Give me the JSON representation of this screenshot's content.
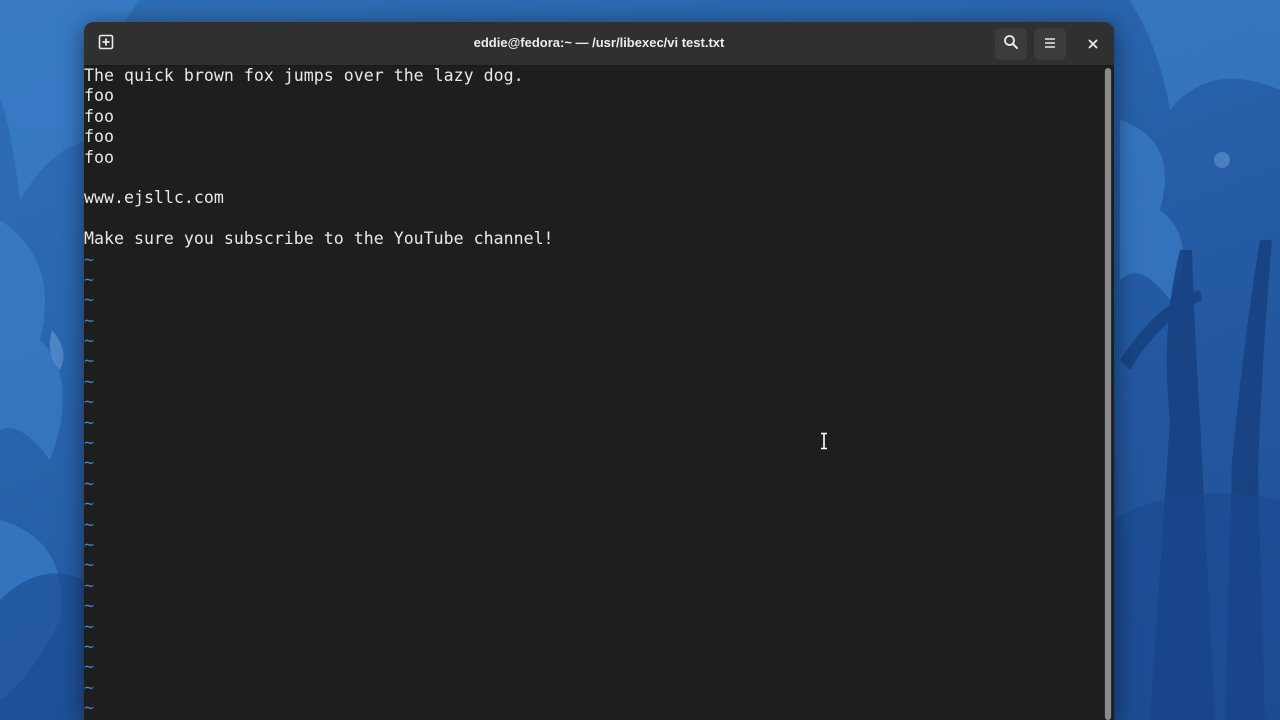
{
  "window": {
    "title": "eddie@fedora:~ — /usr/libexec/vi test.txt"
  },
  "titlebar": {
    "new_tab_icon": "new-tab-icon",
    "search_icon": "search-icon",
    "menu_icon": "hamburger-menu-icon",
    "close_icon": "close-icon"
  },
  "editor": {
    "lines": [
      "The quick brown fox jumps over the lazy dog.",
      "foo",
      "foo",
      "foo",
      "foo",
      "",
      "www.ejsllc.com",
      "",
      "Make sure you subscribe to the YouTube channel!"
    ],
    "empty_line_marker": "~",
    "empty_line_count": 23
  },
  "colors": {
    "terminal_bg": "#1e1e1e",
    "text": "#e8e8e8",
    "tilde": "#4a7fc9",
    "titlebar": "#303030",
    "wallpaper": "#2a66b0"
  }
}
